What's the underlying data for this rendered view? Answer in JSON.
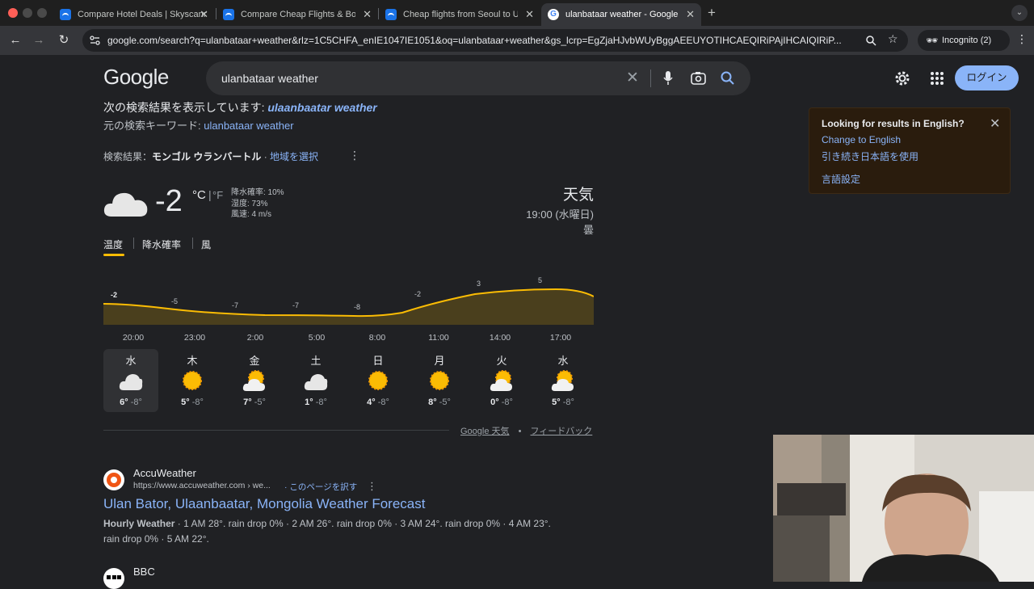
{
  "browser": {
    "tabs": [
      {
        "title": "Compare Hotel Deals | Skyscanner"
      },
      {
        "title": "Compare Cheap Flights & Book"
      },
      {
        "title": "Cheap flights from Seoul to U"
      },
      {
        "title": "ulanbataar weather - Google"
      }
    ],
    "url": "google.com/search?q=ulanbataar+weather&rlz=1C5CHFA_enIE1047IE1051&oq=ulanbataar+weather&gs_lcrp=EgZjaHJvbWUyBggAEEUYOTIHCAEQIRiPAjIHCAIQIRiP...",
    "incognito_label": "Incognito (2)"
  },
  "google": {
    "logo": "Google",
    "query": "ulanbataar weather",
    "login": "ログイン"
  },
  "spell": {
    "showing_prefix": "次の検索結果を表示しています: ",
    "showing_term": "ulaanbaatar weather",
    "original_prefix": "元の検索キーワード: ",
    "original_term": "ulanbataar weather"
  },
  "location": {
    "prefix": "検索結果：",
    "place": "モンゴル ウランバートル",
    "sep": " · ",
    "select": "地域を選択"
  },
  "weather": {
    "temp": "-2",
    "unit_c": "°C",
    "unit_sep": "|",
    "unit_f": "°F",
    "precip": "降水確率: 10%",
    "humidity": "湿度: 73%",
    "wind": "風速: 4 m/s",
    "heading": "天気",
    "time": "19:00 (水曜日)",
    "condition": "曇",
    "tabs": [
      "温度",
      "降水確率",
      "風"
    ],
    "chart_values": [
      "-2",
      "-5",
      "-7",
      "-7",
      "-8",
      "-2",
      "3",
      "5"
    ],
    "hours": [
      "20:00",
      "23:00",
      "2:00",
      "5:00",
      "8:00",
      "11:00",
      "14:00",
      "17:00"
    ],
    "days": [
      {
        "name": "水",
        "icon": "cloudy",
        "hi": "6°",
        "lo": "-8°"
      },
      {
        "name": "木",
        "icon": "sunny",
        "hi": "5°",
        "lo": "-8°"
      },
      {
        "name": "金",
        "icon": "partly-cloudy",
        "hi": "7°",
        "lo": "-5°"
      },
      {
        "name": "土",
        "icon": "cloudy",
        "hi": "1°",
        "lo": "-8°"
      },
      {
        "name": "日",
        "icon": "sunny",
        "hi": "4°",
        "lo": "-8°"
      },
      {
        "name": "月",
        "icon": "sunny",
        "hi": "8°",
        "lo": "-5°"
      },
      {
        "name": "火",
        "icon": "partly-cloudy",
        "hi": "0°",
        "lo": "-8°"
      },
      {
        "name": "水",
        "icon": "partly-cloudy",
        "hi": "5°",
        "lo": "-8°"
      }
    ],
    "source": "Google 天気",
    "dot": "•",
    "feedback": "フィードバック"
  },
  "result1": {
    "site": "AccuWeather",
    "url": "https://www.accuweather.com › we...",
    "translate": "· このページを訳す",
    "title": "Ulan Bator, Ulaanbaatar, Mongolia Weather Forecast",
    "snippet_bold": "Hourly Weather",
    "snippet": " · 1 AM 28°. rain drop 0% · 2 AM 26°. rain drop 0% · 3 AM 24°. rain drop 0% · 4 AM 23°.",
    "snippet2": "rain drop 0% · 5 AM 22°."
  },
  "result2": {
    "site": "BBC"
  },
  "popup": {
    "title": "Looking for results in English?",
    "change": "Change to English",
    "continue": "引き続き日本語を使用",
    "settings": "言語設定"
  },
  "colors": {
    "accent_link": "#8ab4f8",
    "chart_line": "#fbbc04",
    "chart_fill": "#4a3f1d",
    "login_bg": "#8ab4f8"
  }
}
